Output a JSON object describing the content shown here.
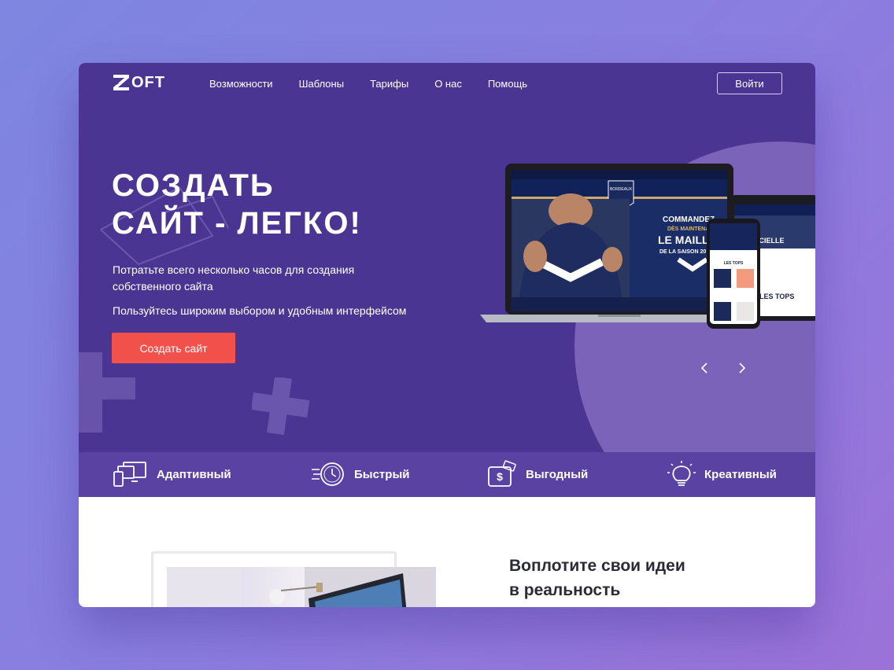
{
  "brand": {
    "logo_text": "OFT",
    "logo_letter": "Z"
  },
  "nav": {
    "items": [
      "Возможности",
      "Шаблоны",
      "Тарифы",
      "О нас",
      "Помощь"
    ],
    "login_label": "Войти"
  },
  "hero": {
    "title_line1": "СОЗДАТЬ",
    "title_line2": "САЙТ - ЛЕГКО!",
    "subtitle": "Потратьте всего несколько часов для создания собственного сайта",
    "subtitle2": "Пользуйтесь широким выбором и удобным интерфейсом",
    "cta_label": "Создать сайт",
    "prev_icon": "chevron-left-icon",
    "next_icon": "chevron-right-icon"
  },
  "mockup": {
    "banner_line1": "COMMANDEZ",
    "banner_line2": "DÈS MAINTENANT",
    "banner_line3": "LE MAILLOT",
    "banner_line4": "DE LA SAISON 20",
    "badge_text": "BORDEAUX",
    "tops_label": "LES TOPS",
    "tablet_label": "LES TOPS",
    "tablet_header": "ICIELLE"
  },
  "features": [
    {
      "label": "Адаптивный",
      "icon": "devices-icon"
    },
    {
      "label": "Быстрый",
      "icon": "fast-clock-icon"
    },
    {
      "label": "Выгодный",
      "icon": "wallet-icon"
    },
    {
      "label": "Креативный",
      "icon": "lightbulb-icon"
    }
  ],
  "section": {
    "title_line1": "Воплотите свои идеи",
    "title_line2": "в реальность"
  },
  "colors": {
    "hero_bg": "#4b3592",
    "circle": "#7a63b8",
    "features_bg": "#5a42a2",
    "cta": "#f2504b",
    "page_bg_from": "#7d86e0",
    "page_bg_to": "#9b72d8"
  }
}
